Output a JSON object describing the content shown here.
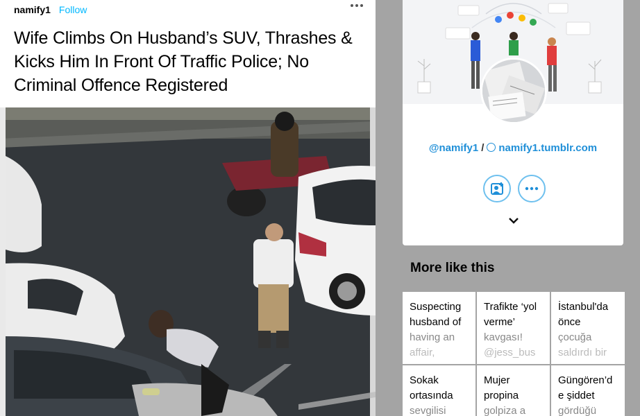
{
  "post": {
    "username": "namify1",
    "follow_label": "Follow",
    "title": "Wife Climbs On Husband’s SUV, Thrashes & Kicks Him In Front Of Traffic Police; No Criminal Offence Registered"
  },
  "blog_card": {
    "handle": "@namify1",
    "separator": "/",
    "url": "namify1.tumblr.com",
    "follow_icon": "add-contact-icon",
    "more_icon": "ellipsis-icon",
    "expand_icon": "chevron-down-icon"
  },
  "more_like_this": {
    "heading": "More like this",
    "tiles": [
      {
        "lines": [
          "Suspecting",
          "husband of",
          "having an",
          "affair,"
        ]
      },
      {
        "lines": [
          "Trafikte ‘yol",
          "verme’",
          "kavgası!",
          "@jess_bus"
        ]
      },
      {
        "lines": [
          "İstanbul'da",
          "önce",
          "çocuğa",
          "saldırdı bir"
        ]
      },
      {
        "lines": [
          "Sokak",
          "ortasında",
          "sevgilisi"
        ]
      },
      {
        "lines": [
          "Mujer",
          "propina",
          "golpiza a"
        ]
      },
      {
        "lines": [
          "Güngören’d",
          "e şiddet",
          "gördüğü"
        ]
      }
    ]
  },
  "colors": {
    "accent": "#00b8ff",
    "link": "#1f8fd8",
    "panel_bg": "#a4a4a4"
  }
}
